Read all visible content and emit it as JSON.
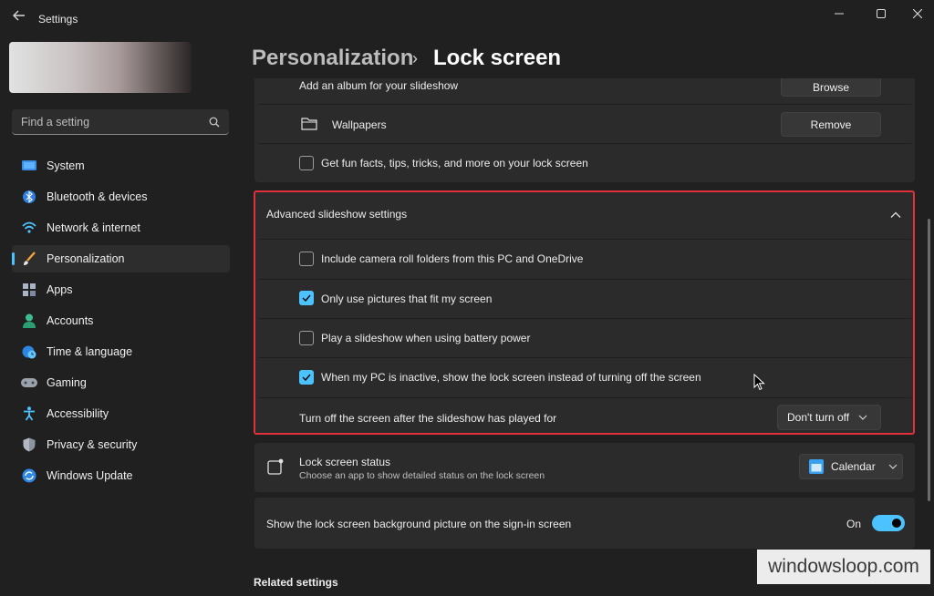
{
  "window": {
    "title": "Settings",
    "controls": [
      "minimize",
      "maximize",
      "close"
    ]
  },
  "sidebar": {
    "search_placeholder": "Find a setting",
    "items": [
      {
        "label": "System",
        "icon": "monitor-icon"
      },
      {
        "label": "Bluetooth & devices",
        "icon": "bluetooth-icon"
      },
      {
        "label": "Network & internet",
        "icon": "wifi-icon"
      },
      {
        "label": "Personalization",
        "icon": "brush-icon",
        "active": true
      },
      {
        "label": "Apps",
        "icon": "apps-icon"
      },
      {
        "label": "Accounts",
        "icon": "person-icon"
      },
      {
        "label": "Time & language",
        "icon": "globe-clock-icon"
      },
      {
        "label": "Gaming",
        "icon": "gamepad-icon"
      },
      {
        "label": "Accessibility",
        "icon": "accessibility-icon"
      },
      {
        "label": "Privacy & security",
        "icon": "shield-icon"
      },
      {
        "label": "Windows Update",
        "icon": "update-icon"
      }
    ]
  },
  "header": {
    "parent": "Personalization",
    "separator": "›",
    "current": "Lock screen"
  },
  "slideshow": {
    "album_label": "Add an album for your slideshow",
    "browse_label": "Browse",
    "folder_name": "Wallpapers",
    "remove_label": "Remove",
    "fun_facts_label": "Get fun facts, tips, tricks, and more on your lock screen",
    "fun_facts_checked": false
  },
  "advanced": {
    "title": "Advanced slideshow settings",
    "expanded": true,
    "options": [
      {
        "label": "Include camera roll folders from this PC and OneDrive",
        "checked": false
      },
      {
        "label": "Only use pictures that fit my screen",
        "checked": true
      },
      {
        "label": "Play a slideshow when using battery power",
        "checked": false
      },
      {
        "label": "When my PC is inactive, show the lock screen instead of turning off the screen",
        "checked": true
      }
    ],
    "turn_off_label": "Turn off the screen after the slideshow has played for",
    "turn_off_value": "Don't turn off"
  },
  "lock_status": {
    "title": "Lock screen status",
    "description": "Choose an app to show detailed status on the lock screen",
    "value": "Calendar"
  },
  "signin_bg": {
    "label": "Show the lock screen background picture on the sign-in screen",
    "state": "On",
    "enabled": true
  },
  "related": {
    "title": "Related settings"
  },
  "watermark": "windowsloop.com",
  "colors": {
    "accent": "#4cc2ff",
    "highlight_border": "#e0303a",
    "background": "#202020",
    "card": "#2b2b2b"
  }
}
